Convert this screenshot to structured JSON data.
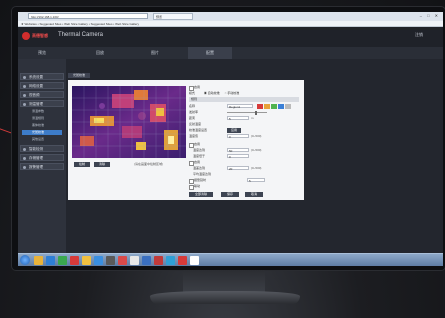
{
  "browser": {
    "address": "http://192.168.1.100/",
    "tab_label": "预览",
    "favorites": "★ Websites • Suggested Sites • Web Slice Gallery • Suggested Sites • Web Slice Gallery",
    "window_buttons": "– □ ✕"
  },
  "app": {
    "logo": "高德智感",
    "title": "Thermal Camera",
    "logout": "注销"
  },
  "nav": {
    "items": [
      "预览",
      "回放",
      "图片",
      "配置"
    ],
    "right": ""
  },
  "sidebar": {
    "items": [
      {
        "label": "系统设置"
      },
      {
        "label": "网络设置"
      },
      {
        "label": "视音频"
      },
      {
        "label": "测温管理"
      }
    ],
    "subitems": [
      {
        "label": "测温参数",
        "active": false
      },
      {
        "label": "测温规则",
        "active": false
      },
      {
        "label": "黑体校准",
        "active": false
      },
      {
        "label": "光斑校准",
        "active": true
      },
      {
        "label": "其他设置",
        "active": false
      }
    ],
    "items2": [
      {
        "label": "智能检测"
      },
      {
        "label": "存储管理"
      },
      {
        "label": "报警管理"
      }
    ]
  },
  "content": {
    "subtab": "光斑校准",
    "preview_buttons": [
      "绘制",
      "清除"
    ],
    "preview_hint": "(请在画面中绘制区域)"
  },
  "form": {
    "enable_label": "启用",
    "mode_label": "模式",
    "mode_options": [
      "自动校准",
      "手动校准"
    ],
    "section1": "规则",
    "name_label": "名称",
    "name_value": "Region1",
    "colors": [
      "#d63a3a",
      "#e8a23a",
      "#4fb34f",
      "#3a7fd6",
      "#bbbbbb"
    ],
    "emissivity_label": "发射率",
    "distance_label": "距离",
    "distance_value": "5",
    "distance_unit": "m",
    "reflect_label": "反射温度",
    "calib_label": "校准温度设置",
    "calib_button": "应用",
    "temp_label": "温度值",
    "temp_value": "0",
    "temp_range": "(0~500)",
    "alarm_section": "报警",
    "alarm_enable": "启用",
    "high_label": "温度达到",
    "high_value": "50",
    "high_range": "(0~500)",
    "low_label": "温度低于",
    "low_value": "0",
    "diff_enable": "启用",
    "diff_label": "温差达到",
    "diff_value": "20",
    "diff_range": "(0~500)",
    "avg_label": "平均温度达到",
    "delay_enable": "报警延时",
    "delay_value": "5",
    "link_label": "联动",
    "buttons": [
      "全部清除",
      "保存",
      "取消"
    ]
  },
  "taskbar": {
    "icons": [
      "#e8b23a",
      "#2e7fd6",
      "#3aa84f",
      "#d63a3a",
      "#f0c040",
      "#3a8fe0",
      "#5a5a5a",
      "#d94a4a",
      "#e8e8e8",
      "#3a6fc0",
      "#c03a3a",
      "#2e9fd6",
      "#d63a3a",
      "#ffffff"
    ],
    "clock": ""
  }
}
